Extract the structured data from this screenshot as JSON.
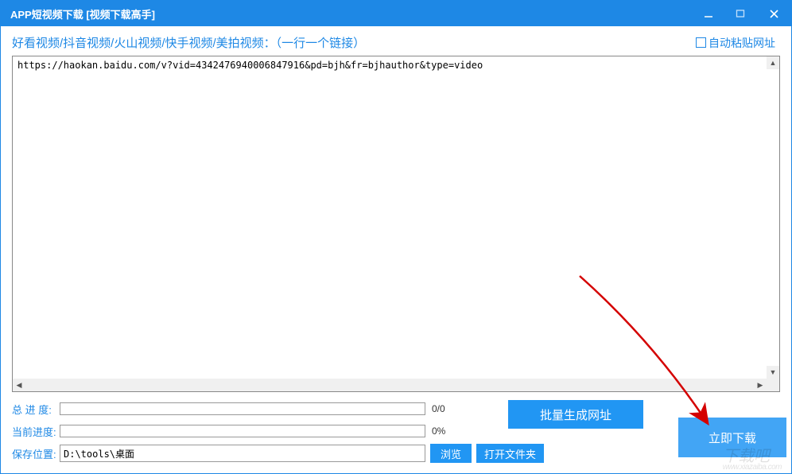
{
  "window": {
    "title": "APP短视频下载 [视频下载高手]"
  },
  "header": {
    "label": "好看视频/抖音视频/火山视频/快手视频/美拍视频：（一行一个链接）",
    "auto_paste": "自动粘贴网址"
  },
  "urls": {
    "text": "https://haokan.baidu.com/v?vid=4342476940006847916&pd=bjh&fr=bjhauthor&type=video"
  },
  "progress": {
    "total_label": "总 进 度:",
    "total_text": "0/0",
    "current_label": "当前进度:",
    "current_text": "0%"
  },
  "save": {
    "label": "保存位置:",
    "path": "D:\\tools\\桌面"
  },
  "buttons": {
    "browse": "浏览",
    "open_folder": "打开文件夹",
    "batch": "批量生成网址",
    "download": "立即下载"
  },
  "watermark": {
    "main": "下载吧",
    "sub": "www.xiazaiba.com"
  }
}
